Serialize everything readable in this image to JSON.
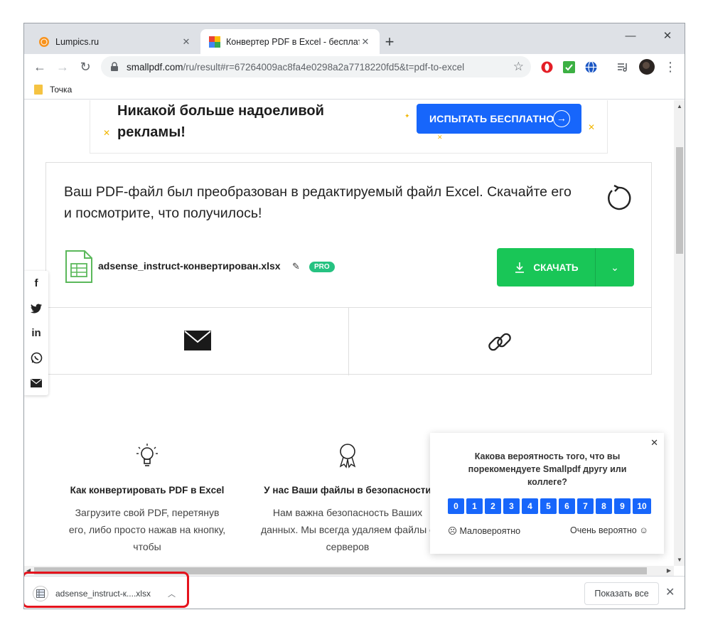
{
  "tabs": [
    {
      "title": "Lumpics.ru",
      "close": "✕"
    },
    {
      "title": "Конвертер PDF в Excel - бесплатн",
      "close": "✕"
    }
  ],
  "window_controls": {
    "minimize": "—",
    "maximize": "☐",
    "close": "✕"
  },
  "address_bar": {
    "host": "smallpdf.com",
    "path": "/ru/result#r=67264009ac8fa4e0298a2a7718220fd5&t=pdf-to-excel"
  },
  "bookmarks": [
    {
      "label": "Точка"
    }
  ],
  "ad": {
    "text": "Никакой больше надоеливой рекламы!",
    "button": "ИСПЫТАТЬ БЕСПЛАТНО"
  },
  "result": {
    "message": "Ваш PDF-файл был преобразован в редактируемый файл Excel. Скачайте его и посмотрите, что получилось!",
    "file_name": "adsense_instruct-конвертирован.xlsx",
    "pro_badge": "PRO",
    "download_label": "СКАЧАТЬ"
  },
  "features": [
    {
      "title": "Как конвертировать PDF в Excel",
      "text": "Загрузите свой PDF, перетянув его, либо просто нажав на кнопку, чтобы"
    },
    {
      "title": "У нас Ваши файлы в безопасности",
      "text": "Нам важна безопасность Ваших данных. Мы всегда удаляем файлы с серверов"
    }
  ],
  "survey": {
    "question": "Какова вероятность того, что вы порекомендуете Smallpdf другу или коллеге?",
    "scale": [
      "0",
      "1",
      "2",
      "3",
      "4",
      "5",
      "6",
      "7",
      "8",
      "9",
      "10"
    ],
    "low_label": "☹ Маловероятно",
    "high_label": "Очень вероятно ☺"
  },
  "download_shelf": {
    "file": "adsense_instruct-к....xlsx",
    "show_all": "Показать все"
  },
  "colors": {
    "accent_blue": "#1766fb",
    "download_green": "#19c657",
    "highlight_red": "#e5131d",
    "pro_green": "#26c281"
  }
}
